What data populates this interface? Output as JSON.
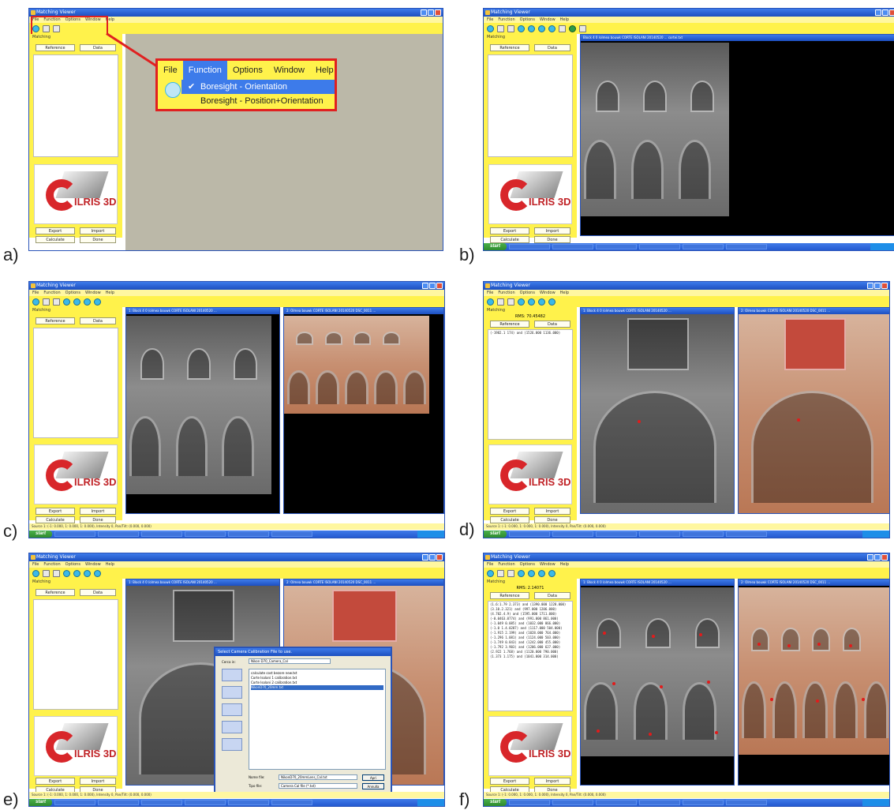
{
  "panels": {
    "a": {
      "label": "a)"
    },
    "b": {
      "label": "b)"
    },
    "c": {
      "label": "c)"
    },
    "d": {
      "label": "d)"
    },
    "e": {
      "label": "e)"
    },
    "f": {
      "label": "f)"
    }
  },
  "app": {
    "title": "Matching Viewer",
    "menu": [
      "File",
      "Function",
      "Options",
      "Window",
      "Help"
    ],
    "sidebar_title": "Matching",
    "reference_label": "Reference",
    "data_label": "Data",
    "export_label": "Export",
    "import_label": "Import",
    "calculate_label": "Calculate",
    "done_label": "Done",
    "logo_text": "ILRIS 3D",
    "start_label": "start"
  },
  "zoom_menu": {
    "items": [
      "File",
      "Function",
      "Options",
      "Window",
      "Help"
    ],
    "active": "Function",
    "options": [
      "Boresight - Orientation",
      "Boresight - Position+Orientation"
    ],
    "checked_index": 0
  },
  "viewer_b": {
    "title": "Block 4 0 /olmea bouwk CORTE ISOLANI 20140520 ... cortei.txt"
  },
  "viewer_c": {
    "left_title": "1: Block 4 0 /olmea bouwk CORTE ISOLANI 20140520 ...",
    "right_title": "2: Olmea bouwk CORTE ISOLANI 20140520 DSC_0011 ..."
  },
  "panel_d": {
    "rms": "RMS: 70.45482",
    "row": "(-1982.1 174) and (1526.000 1136.000)"
  },
  "dialog_e": {
    "title": "Select Camera Calibration File to use.",
    "look_in_label": "Cerca in:",
    "look_in_value": "Nikon D70_Camera_Cal",
    "files": [
      "calculate cost bezore new.txt",
      "Corte Isolani 1 calibration.txt",
      "Corte Isolani 2 calibration.txt",
      "NikonD70_20mm.txt"
    ],
    "selected_file_index": 3,
    "filename_label": "Nome file:",
    "filename_value": "NikonD70_20mmLens_Cal.txt",
    "filetype_label": "Tipo file:",
    "filetype_value": "Camera Cal file (*.txt)",
    "open_label": "Apri",
    "cancel_label": "Annulla",
    "places": [
      "Documenti recenti",
      "Desktop",
      "Documenti",
      "Risorse del computer",
      "Risorse di rete"
    ]
  },
  "panel_f": {
    "rms": "RMS: 2.14071",
    "rows": [
      "(1.6:1.79 2.373) and (1390.000 1228.000)",
      "(3.10.2.321) and (997.000 1206.000)",
      "(4.702.4.9) and (1595.000 1711.000)",
      "(-0.0463.0774) and (991.000 861.000)",
      "(-1.049 0.085) and (1032.000 866.000)",
      "(-1.0 1.4.0287) and (1117.000 504.000)",
      "(-1.915 2.199) and (1028.000 764.000)",
      "(-1.296 1.081) and (1124.000 503.000)",
      "(-1.749 0.843) and (1242.000 455.000)",
      "(-1.792 3.903) and (1206.000 627.000)",
      "(2.922 1.768) and (1120.000 790.000)",
      "(1.373 1.175) and (1041.000 314.000)"
    ]
  },
  "status": "Source 1: (-1: 0.000, 1: 0.000, 1: 0.000), Intensity 0, Pan/Tilt: (0.000, 0.000)"
}
